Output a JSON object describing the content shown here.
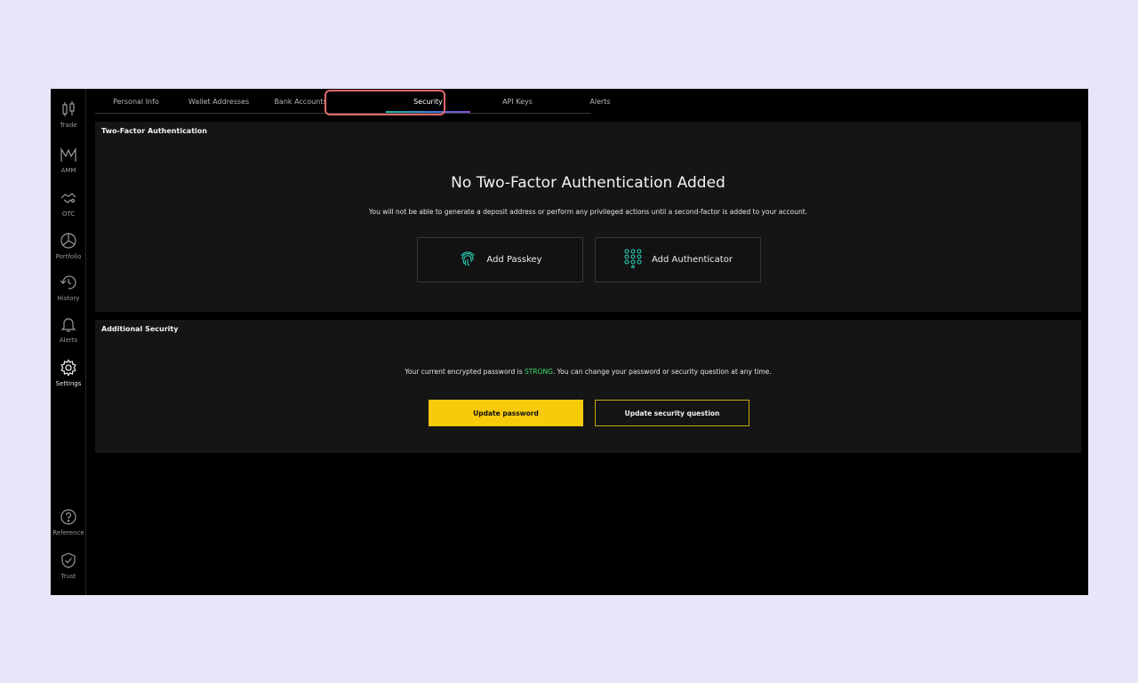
{
  "sidebar": {
    "items": [
      {
        "label": "Trade",
        "icon": "candlestick-icon"
      },
      {
        "label": "AMM",
        "icon": "amm-icon"
      },
      {
        "label": "OTC",
        "icon": "handshake-icon"
      },
      {
        "label": "Portfolio",
        "icon": "pie-chart-icon"
      },
      {
        "label": "History",
        "icon": "history-icon"
      },
      {
        "label": "Alerts",
        "icon": "bell-icon"
      },
      {
        "label": "Settings",
        "icon": "gear-icon"
      },
      {
        "label": "Reference",
        "icon": "help-icon"
      },
      {
        "label": "Trust",
        "icon": "shield-check-icon"
      }
    ],
    "active": "Settings"
  },
  "tabs": [
    {
      "label": "Personal Info"
    },
    {
      "label": "Wallet Addresses"
    },
    {
      "label": "Bank Accounts"
    },
    {
      "label": "Security"
    },
    {
      "label": "API Keys"
    },
    {
      "label": "Alerts"
    }
  ],
  "active_tab": "Security",
  "two_factor": {
    "title": "Two-Factor Authentication",
    "heading": "No Two-Factor Authentication Added",
    "description": "You will not be able to generate a deposit address or perform any privileged actions until a second-factor is added to your account.",
    "add_passkey_label": "Add Passkey",
    "add_authenticator_label": "Add Authenticator"
  },
  "additional_security": {
    "title": "Additional Security",
    "desc_before": "Your current encrypted password is ",
    "strength": "STRONG",
    "desc_after": ". You can change your password or security question at any time.",
    "update_password_label": "Update password",
    "update_question_label": "Update security question"
  },
  "colors": {
    "accent_yellow": "#f7cb0a",
    "strong_green": "#3ddc6b",
    "highlight_red": "#e06a6e"
  }
}
